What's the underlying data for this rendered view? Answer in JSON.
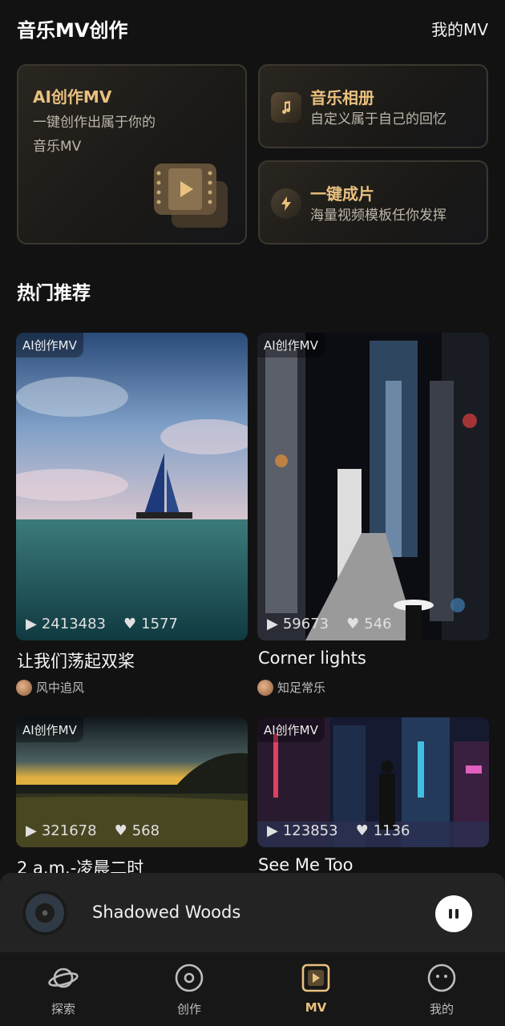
{
  "header": {
    "title": "音乐MV创作",
    "my_mv": "我的MV"
  },
  "cards": {
    "ai": {
      "title": "AI创作MV",
      "subtitle_line1": "一键创作出属于你的",
      "subtitle_line2": "音乐MV",
      "icon": "film-icon"
    },
    "album": {
      "title": "音乐相册",
      "subtitle": "自定义属于自己的回忆",
      "icon": "music-note-icon"
    },
    "oneclick": {
      "title": "一键成片",
      "subtitle": "海量视频模板任你发挥",
      "icon": "lightning-icon"
    }
  },
  "section": {
    "title": "热门推荐"
  },
  "items": [
    {
      "badge": "AI创作MV",
      "plays": "2413483",
      "likes": "1577",
      "title": "让我们荡起双桨",
      "author": "风中追风"
    },
    {
      "badge": "AI创作MV",
      "plays": "59673",
      "likes": "546",
      "title": "Corner lights",
      "author": "知足常乐"
    },
    {
      "badge": "AI创作MV",
      "plays": "321678",
      "likes": "568",
      "title": "2 a.m.-凌晨二时",
      "author": ""
    },
    {
      "badge": "AI创作MV",
      "plays": "123853",
      "likes": "1136",
      "title": "See Me Too",
      "author": ""
    }
  ],
  "player": {
    "song": "Shadowed Woods",
    "state": "playing"
  },
  "tabs": [
    {
      "label": "探索",
      "icon": "planet-icon"
    },
    {
      "label": "创作",
      "icon": "disc-icon"
    },
    {
      "label": "MV",
      "icon": "mv-play-icon",
      "active": true
    },
    {
      "label": "我的",
      "icon": "face-icon"
    }
  ],
  "colors": {
    "accent": "#e9c17f",
    "background": "#121212"
  }
}
